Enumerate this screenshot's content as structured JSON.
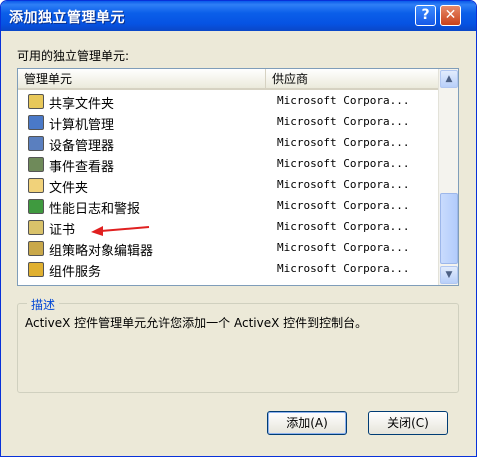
{
  "window": {
    "title": "添加独立管理单元",
    "help_glyph": "?",
    "close_glyph": "✕"
  },
  "list": {
    "label": "可用的独立管理单元:",
    "columns": [
      "管理单元",
      "供应商"
    ],
    "items": [
      {
        "name": "共享文件夹",
        "vendor": "Microsoft Corpora...",
        "icon": "shared-folder-icon",
        "color": "#e8c85a"
      },
      {
        "name": "计算机管理",
        "vendor": "Microsoft Corpora...",
        "icon": "computer-management-icon",
        "color": "#4a79c8"
      },
      {
        "name": "设备管理器",
        "vendor": "Microsoft Corpora...",
        "icon": "device-manager-icon",
        "color": "#5a7fbf"
      },
      {
        "name": "事件查看器",
        "vendor": "Microsoft Corpora...",
        "icon": "event-viewer-icon",
        "color": "#6f8a5a"
      },
      {
        "name": "文件夹",
        "vendor": "Microsoft Corpora...",
        "icon": "folder-icon",
        "color": "#f1d27a"
      },
      {
        "name": "性能日志和警报",
        "vendor": "Microsoft Corpora...",
        "icon": "performance-logs-icon",
        "color": "#3f9a3f"
      },
      {
        "name": "证书",
        "vendor": "Microsoft Corpora...",
        "icon": "certificate-icon",
        "color": "#d9c26a"
      },
      {
        "name": "组策略对象编辑器",
        "vendor": "Microsoft Corpora...",
        "icon": "group-policy-icon",
        "color": "#c9a84a"
      },
      {
        "name": "组件服务",
        "vendor": "Microsoft Corpora...",
        "icon": "component-services-icon",
        "color": "#e0b030"
      }
    ],
    "scroll_up_glyph": "▲",
    "scroll_down_glyph": "▼"
  },
  "description": {
    "title": "描述",
    "text": "ActiveX 控件管理单元允许您添加一个 ActiveX 控件到控制台。"
  },
  "buttons": {
    "add": "添加(A)",
    "close": "关闭(C)"
  },
  "annotation": {
    "arrow_color": "#e02020"
  }
}
